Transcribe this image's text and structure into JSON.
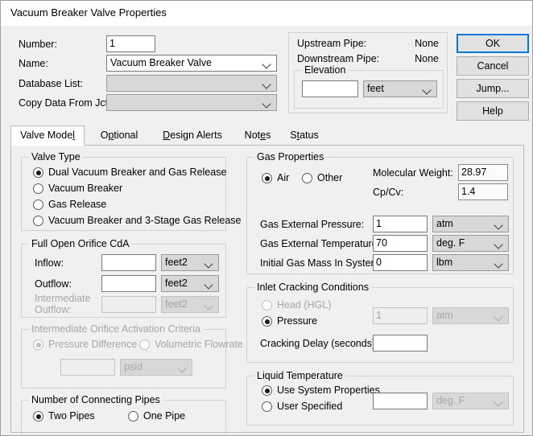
{
  "window": {
    "title": "Vacuum Breaker Valve Properties"
  },
  "header": {
    "number_label": "Number:",
    "number_value": "1",
    "name_label": "Name:",
    "name_value": "Vacuum Breaker Valve",
    "database_list_label": "Database List:",
    "database_list_value": "",
    "copy_data_label": "Copy Data From Jct...",
    "copy_data_value": ""
  },
  "pipe_info": {
    "upstream_label": "Upstream Pipe:",
    "upstream_value": "None",
    "downstream_label": "Downstream Pipe:",
    "downstream_value": "None",
    "elevation_group": "Elevation",
    "elevation_value": "",
    "elevation_unit": "feet"
  },
  "buttons": {
    "ok": "OK",
    "cancel": "Cancel",
    "jump": "Jump...",
    "help": "Help"
  },
  "tabs": [
    {
      "label": "Valve Model",
      "mnemonic_index": 10,
      "selected": true
    },
    {
      "label": "Optional",
      "mnemonic_index": 1,
      "selected": false
    },
    {
      "label": "Design Alerts",
      "mnemonic_index": 0,
      "selected": false
    },
    {
      "label": "Notes",
      "mnemonic_index": 3,
      "selected": false
    },
    {
      "label": "Status",
      "mnemonic_index": 1,
      "selected": false
    }
  ],
  "valve_type": {
    "title": "Valve Type",
    "options": [
      {
        "label": "Dual Vacuum Breaker and Gas Release",
        "selected": true
      },
      {
        "label": "Vacuum Breaker",
        "selected": false
      },
      {
        "label": "Gas Release",
        "selected": false
      },
      {
        "label": "Vacuum Breaker and 3-Stage Gas Release",
        "selected": false
      }
    ]
  },
  "orifice": {
    "title": "Full Open Orifice CdA",
    "inflow_label": "Inflow:",
    "inflow_value": "",
    "inflow_unit": "feet2",
    "outflow_label": "Outflow:",
    "outflow_value": "",
    "outflow_unit": "feet2",
    "intermediate_label_line1": "Intermediate",
    "intermediate_label_line2": "Outflow:",
    "intermediate_value": "",
    "intermediate_unit": "feet2"
  },
  "activation": {
    "title": "Intermediate Orifice Activation Criteria",
    "options": [
      {
        "label": "Pressure Difference",
        "selected": true
      },
      {
        "label": "Volumetric Flowrate",
        "selected": false
      }
    ],
    "value": "",
    "unit": "psid"
  },
  "connecting_pipes": {
    "title": "Number of Connecting Pipes",
    "options": [
      {
        "label": "Two Pipes",
        "selected": true
      },
      {
        "label": "One Pipe",
        "selected": false
      }
    ]
  },
  "gas_properties": {
    "title": "Gas Properties",
    "gas_options": [
      {
        "label": "Air",
        "selected": true
      },
      {
        "label": "Other",
        "selected": false
      }
    ],
    "molecular_weight_label": "Molecular Weight:",
    "molecular_weight_value": "28.97",
    "cp_cv_label": "Cp/Cv:",
    "cp_cv_value": "1.4",
    "ext_pressure_label": "Gas External Pressure:",
    "ext_pressure_value": "1",
    "ext_pressure_unit": "atm",
    "ext_temp_label": "Gas External Temperature:",
    "ext_temp_value": "70",
    "ext_temp_unit": "deg. F",
    "initial_mass_label": "Initial Gas Mass In System:",
    "initial_mass_value": "0",
    "initial_mass_unit": "lbm"
  },
  "cracking": {
    "title": "Inlet Cracking Conditions",
    "options": [
      {
        "label": "Head (HGL)",
        "selected": false,
        "disabled": true
      },
      {
        "label": "Pressure",
        "selected": true,
        "disabled": false
      }
    ],
    "value": "1",
    "unit": "atm",
    "delay_label": "Cracking Delay (seconds)",
    "delay_value": ""
  },
  "liquid_temperature": {
    "title": "Liquid Temperature",
    "options": [
      {
        "label": "Use System Properties",
        "selected": true
      },
      {
        "label": "User Specified",
        "selected": false
      }
    ],
    "value": "",
    "unit": "deg. F"
  },
  "colors": {
    "accent": "#0078d7",
    "dialog_bg": "#f0f0f0",
    "panel_bg": "#f0f0f0",
    "field_bg": "#ffffff",
    "disabled_text": "#a6a6a6"
  }
}
